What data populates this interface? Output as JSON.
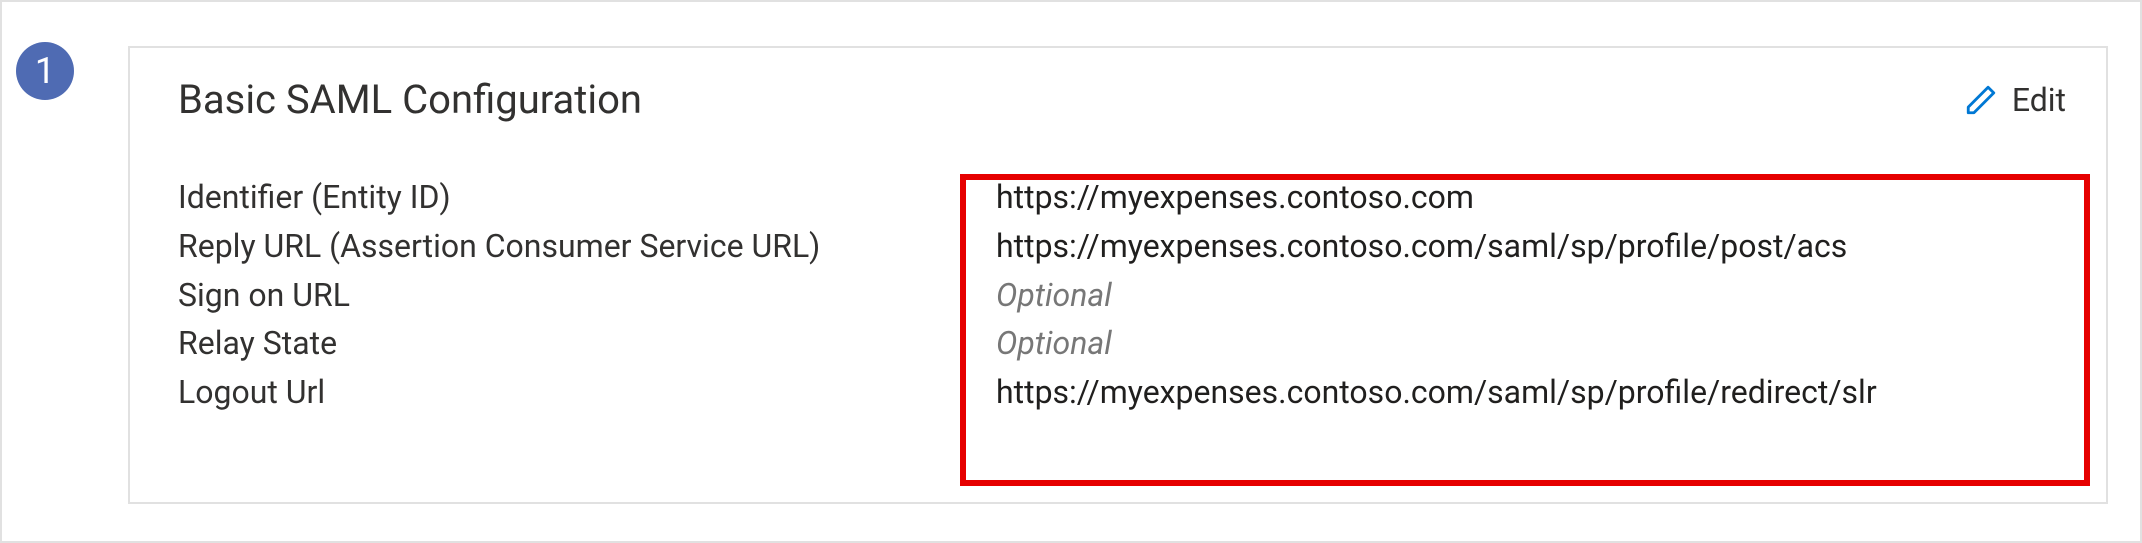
{
  "step": {
    "number": "1"
  },
  "card": {
    "title": "Basic SAML Configuration",
    "edit_label": "Edit",
    "fields": {
      "identifier": {
        "label": "Identifier (Entity ID)",
        "value": "https://myexpenses.contoso.com"
      },
      "reply_url": {
        "label": "Reply URL (Assertion Consumer Service URL)",
        "value": "https://myexpenses.contoso.com/saml/sp/profile/post/acs"
      },
      "sign_on_url": {
        "label": "Sign on URL",
        "value": "Optional"
      },
      "relay_state": {
        "label": "Relay State",
        "value": "Optional"
      },
      "logout_url": {
        "label": "Logout Url",
        "value": "https://myexpenses.contoso.com/saml/sp/profile/redirect/slr"
      }
    }
  },
  "colors": {
    "step_badge": "#4f6bb3",
    "highlight": "#e60000",
    "edit_icon": "#0078d4"
  }
}
